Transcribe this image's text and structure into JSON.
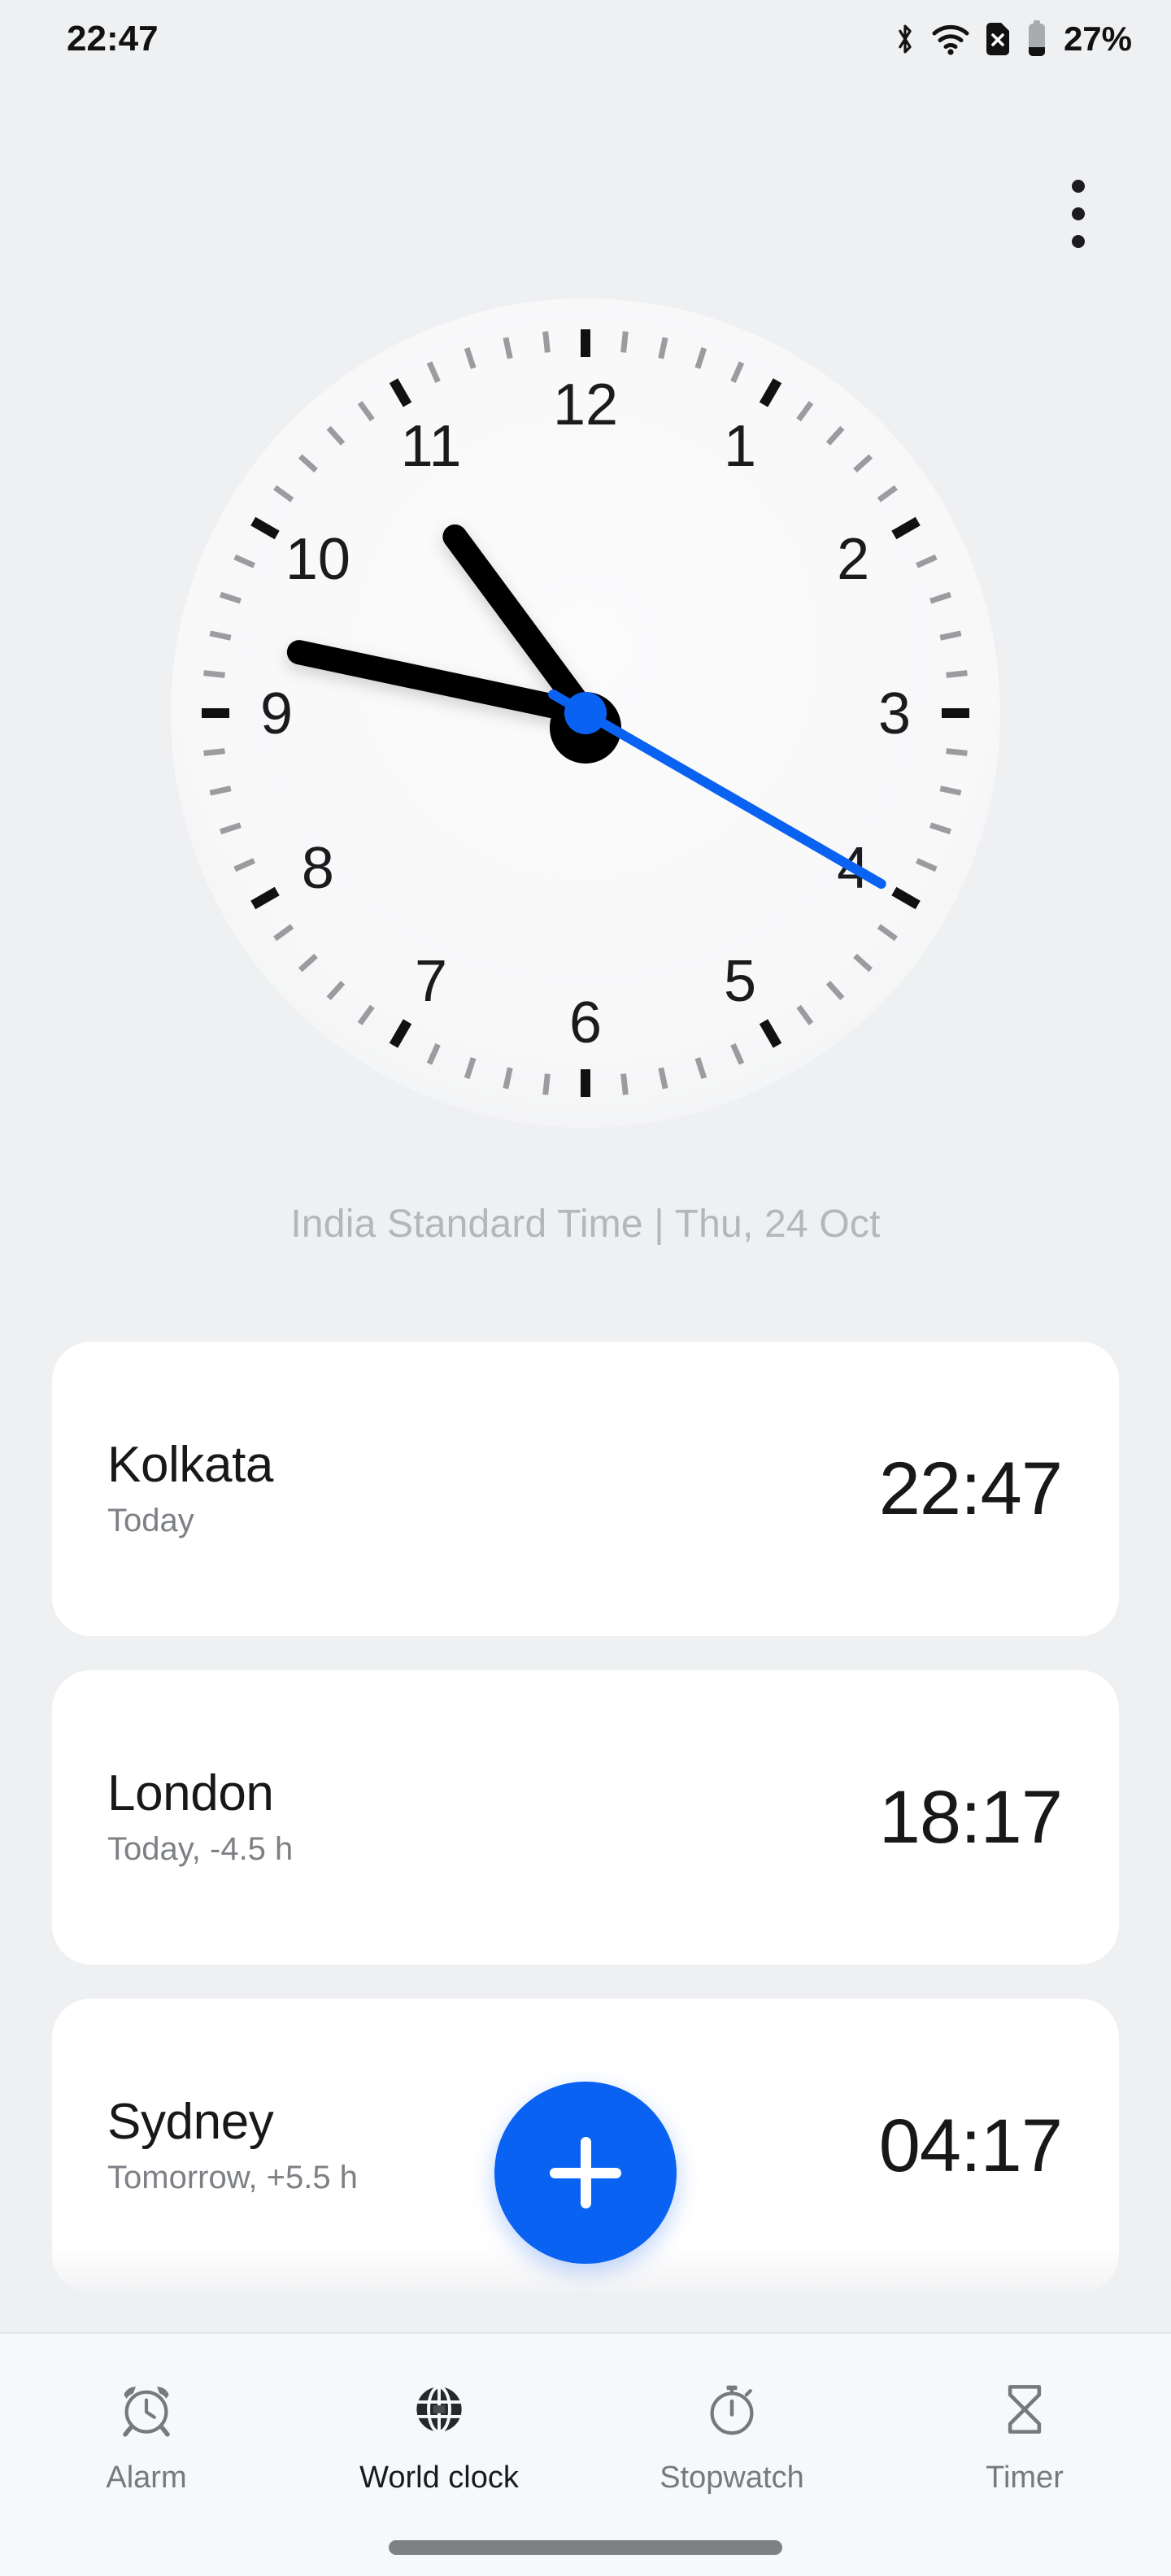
{
  "status_bar": {
    "time": "22:47",
    "battery_percent": "27%",
    "icons": [
      "bluetooth-icon",
      "wifi-icon",
      "sim-off-icon",
      "battery-icon"
    ]
  },
  "app_bar": {
    "overflow_menu_label": "More options",
    "overflow_icon": "three-dot-menu-icon"
  },
  "analog_clock": {
    "hour_numerals": [
      "12",
      "1",
      "2",
      "3",
      "4",
      "5",
      "6",
      "7",
      "8",
      "9",
      "10",
      "11"
    ],
    "hour_hand_angle_deg": 323.5,
    "minute_hand_angle_deg": 282,
    "second_hand_angle_deg": 120,
    "second_hand_color": "#0a62f2",
    "hand_color": "#000000",
    "face_color": "#fafafa",
    "tick_color": "#9a9c9f",
    "hour_tick_color": "#111111"
  },
  "timezone_caption": "India Standard Time | Thu, 24 Oct",
  "cities": [
    {
      "name": "Kolkata",
      "subtitle": "Today",
      "time": "22:47"
    },
    {
      "name": "London",
      "subtitle": "Today, -4.5 h",
      "time": "18:17"
    },
    {
      "name": "Sydney",
      "subtitle": "Tomorrow, +5.5 h",
      "time": "04:17"
    }
  ],
  "fab": {
    "label": "Add city",
    "icon": "plus-icon",
    "color": "#0a62f2"
  },
  "bottom_nav": {
    "items": [
      {
        "label": "Alarm",
        "icon": "alarm-clock-icon",
        "active": false
      },
      {
        "label": "World clock",
        "icon": "globe-icon",
        "active": true
      },
      {
        "label": "Stopwatch",
        "icon": "stopwatch-icon",
        "active": false
      },
      {
        "label": "Timer",
        "icon": "hourglass-icon",
        "active": false
      }
    ]
  },
  "colors": {
    "background": "#eff0f2",
    "card": "#ffffff",
    "accent": "#0a62f2",
    "text_primary": "#17181a",
    "text_secondary": "#7d8084",
    "text_muted": "#b3b6ba"
  }
}
